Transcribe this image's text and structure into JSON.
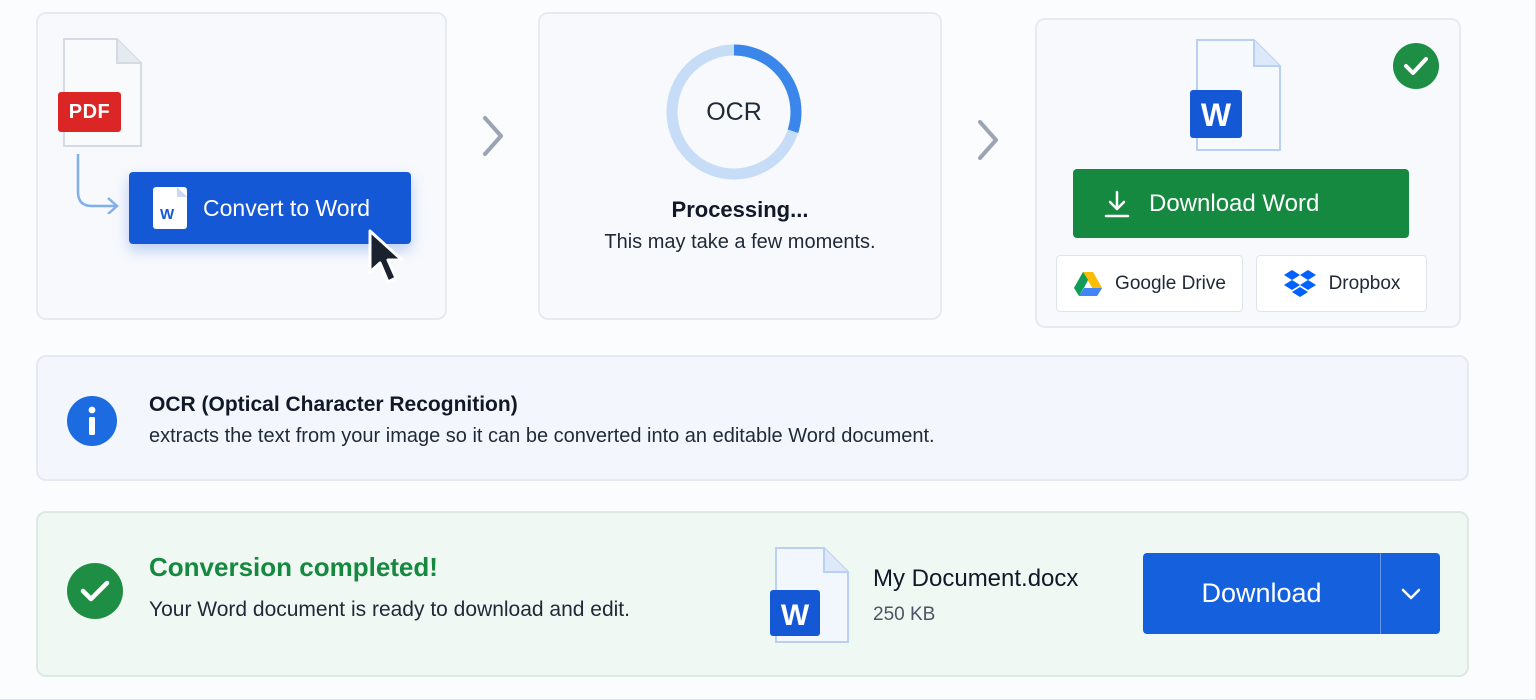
{
  "step1": {
    "pdf_badge": "PDF",
    "word_letter": "W",
    "convert_label": "Convert to Word"
  },
  "step2": {
    "ring_label": "OCR",
    "progress": 0.3,
    "title": "Processing...",
    "subtitle": "This may take a few moments."
  },
  "step3": {
    "word_letter": "W",
    "download_label": "Download Word",
    "google_drive_label": "Google Drive",
    "dropbox_label": "Dropbox"
  },
  "info": {
    "icon": "info-icon",
    "title": "OCR (Optical Character Recognition)",
    "text": "extracts the text from your image so it can be converted into an editable Word document."
  },
  "success": {
    "title": "Conversion completed!",
    "text": "Your Word document is ready to download and edit.",
    "file_name": "My Document.docx",
    "file_size": "250 KB",
    "file_letter": "W",
    "download_label": "Download"
  },
  "colors": {
    "primary_blue": "#1558d6",
    "success_green": "#15893f",
    "pdf_red": "#dc2626"
  }
}
